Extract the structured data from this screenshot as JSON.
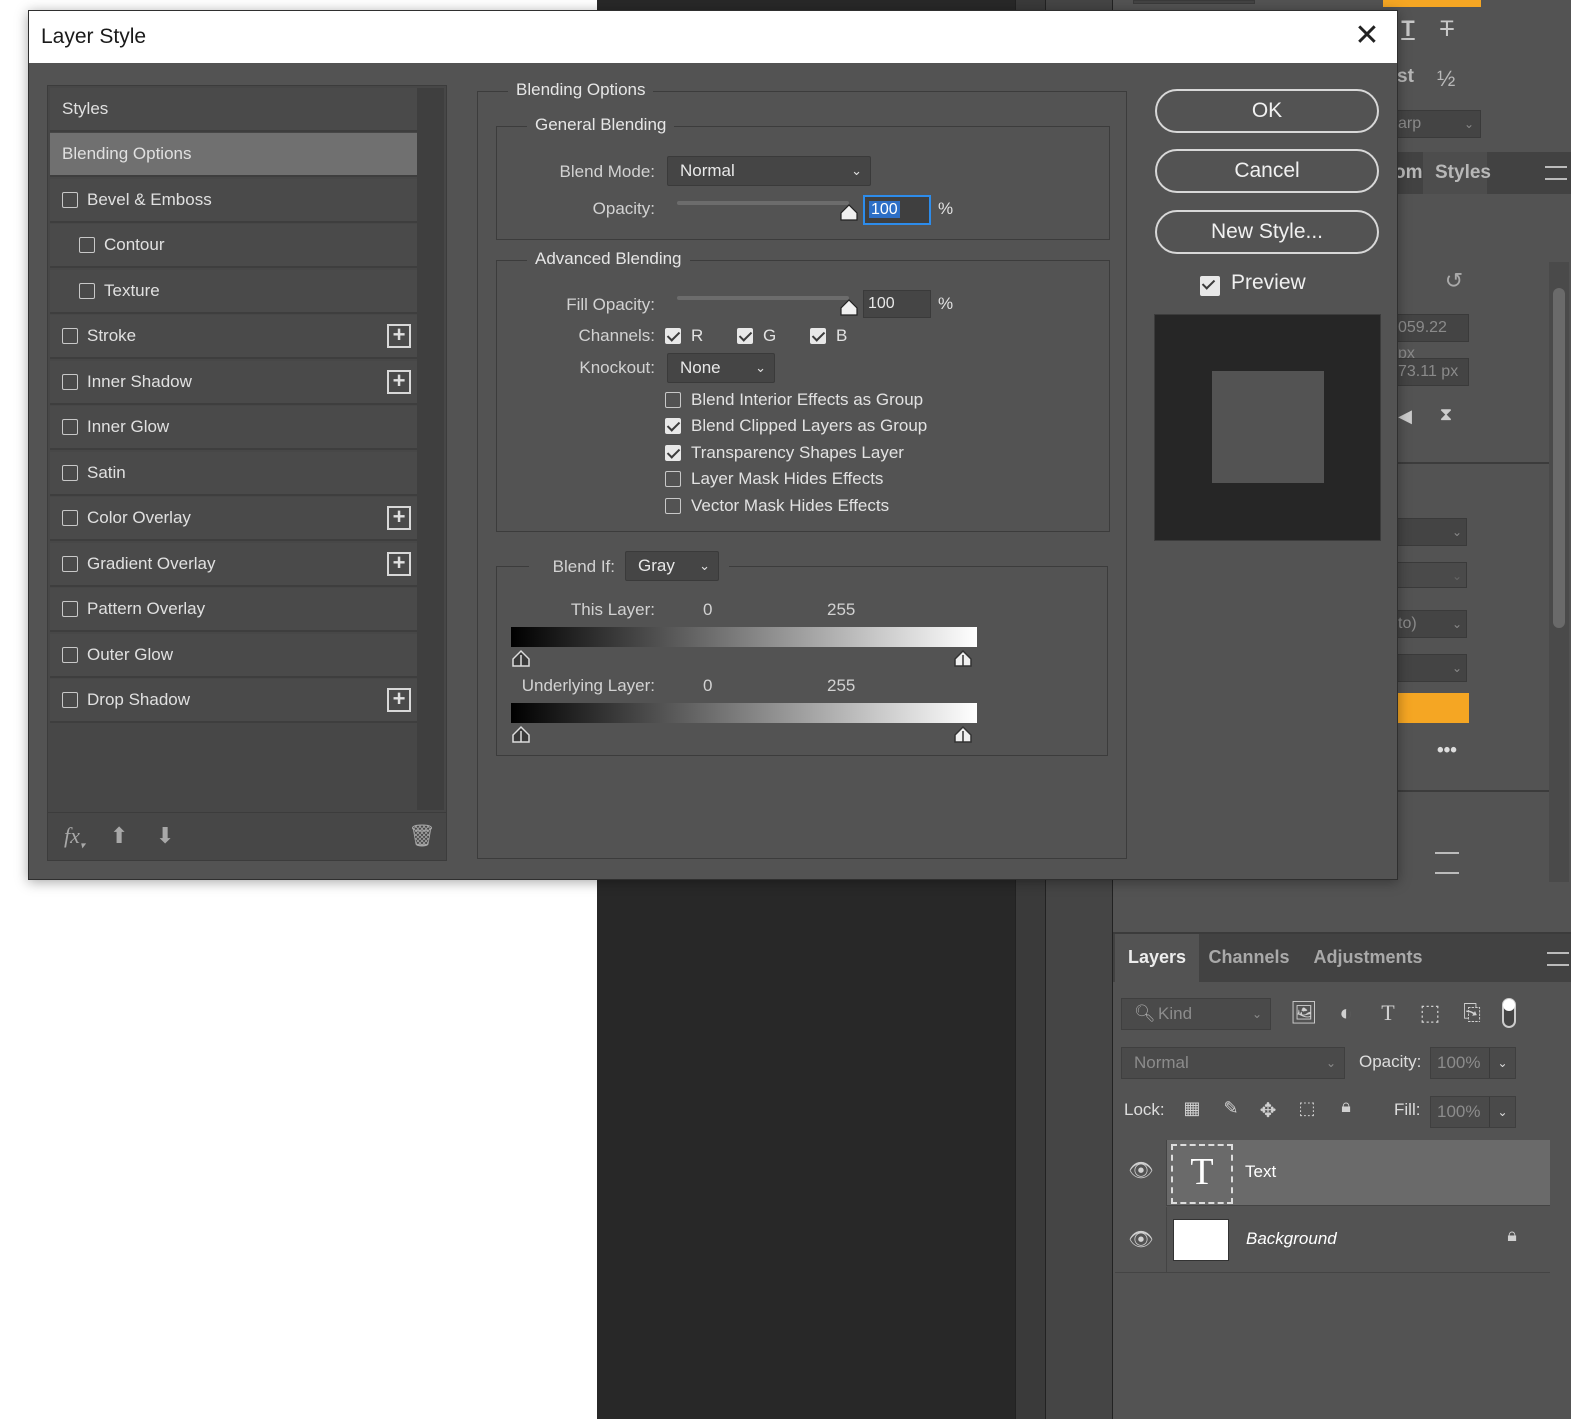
{
  "dialog": {
    "title": "Layer Style",
    "styles_list": {
      "header": "Styles",
      "items": [
        {
          "label": "Blending Options",
          "selected": true,
          "checkbox": false,
          "plus": false,
          "indent": false
        },
        {
          "label": "Bevel & Emboss",
          "checked": false,
          "checkbox": true,
          "plus": false,
          "indent": false
        },
        {
          "label": "Contour",
          "checked": false,
          "checkbox": true,
          "plus": false,
          "indent": true
        },
        {
          "label": "Texture",
          "checked": false,
          "checkbox": true,
          "plus": false,
          "indent": true
        },
        {
          "label": "Stroke",
          "checked": false,
          "checkbox": true,
          "plus": true,
          "indent": false
        },
        {
          "label": "Inner Shadow",
          "checked": false,
          "checkbox": true,
          "plus": true,
          "indent": false
        },
        {
          "label": "Inner Glow",
          "checked": false,
          "checkbox": true,
          "plus": false,
          "indent": false
        },
        {
          "label": "Satin",
          "checked": false,
          "checkbox": true,
          "plus": false,
          "indent": false
        },
        {
          "label": "Color Overlay",
          "checked": false,
          "checkbox": true,
          "plus": true,
          "indent": false
        },
        {
          "label": "Gradient Overlay",
          "checked": false,
          "checkbox": true,
          "plus": true,
          "indent": false
        },
        {
          "label": "Pattern Overlay",
          "checked": false,
          "checkbox": true,
          "plus": false,
          "indent": false
        },
        {
          "label": "Outer Glow",
          "checked": false,
          "checkbox": true,
          "plus": false,
          "indent": false
        },
        {
          "label": "Drop Shadow",
          "checked": false,
          "checkbox": true,
          "plus": true,
          "indent": false
        }
      ],
      "footer_icons": [
        "fx-icon",
        "move-up-icon",
        "move-down-icon",
        "trash-icon"
      ],
      "fx_label": "fx"
    },
    "blending_options": {
      "title": "Blending Options",
      "general": {
        "title": "General Blending",
        "blend_mode_label": "Blend Mode:",
        "blend_mode_value": "Normal",
        "opacity_label": "Opacity:",
        "opacity_value": "100",
        "opacity_unit": "%",
        "opacity_fraction": 1.0
      },
      "advanced": {
        "title": "Advanced Blending",
        "fill_opacity_label": "Fill Opacity:",
        "fill_opacity_value": "100",
        "fill_opacity_unit": "%",
        "fill_opacity_fraction": 1.0,
        "channels_label": "Channels:",
        "channels": [
          {
            "label": "R",
            "checked": true
          },
          {
            "label": "G",
            "checked": true
          },
          {
            "label": "B",
            "checked": true
          }
        ],
        "knockout_label": "Knockout:",
        "knockout_value": "None",
        "options": [
          {
            "label": "Blend Interior Effects as Group",
            "checked": false
          },
          {
            "label": "Blend Clipped Layers as Group",
            "checked": true
          },
          {
            "label": "Transparency Shapes Layer",
            "checked": true
          },
          {
            "label": "Layer Mask Hides Effects",
            "checked": false
          },
          {
            "label": "Vector Mask Hides Effects",
            "checked": false
          }
        ]
      },
      "blend_if": {
        "label": "Blend If:",
        "value": "Gray",
        "this_layer_label": "This Layer:",
        "this_layer_min": "0",
        "this_layer_max": "255",
        "underlying_label": "Underlying Layer:",
        "underlying_min": "0",
        "underlying_max": "255"
      }
    },
    "buttons": {
      "ok": "OK",
      "cancel": "Cancel",
      "new_style": "New Style...",
      "preview_label": "Preview",
      "preview_checked": true
    }
  },
  "background_panel": {
    "top_fragments": [
      "st",
      "½",
      "arp",
      "om",
      "Styles"
    ],
    "fields": [
      "059.22 px",
      "73.11 px",
      "to)"
    ],
    "accent_color": "#f5a623"
  },
  "layers_panel": {
    "tabs": [
      "Layers",
      "Channels",
      "Adjustments"
    ],
    "active_tab": "Layers",
    "filter_placeholder": "Kind",
    "blend_mode": "Normal",
    "opacity_label": "Opacity:",
    "opacity_value": "100%",
    "lock_label": "Lock:",
    "fill_label": "Fill:",
    "fill_value": "100%",
    "layers": [
      {
        "name": "Text",
        "type": "text",
        "visible": true,
        "selected": true,
        "locked": false
      },
      {
        "name": "Background",
        "type": "raster",
        "visible": true,
        "selected": false,
        "locked": true
      }
    ]
  }
}
